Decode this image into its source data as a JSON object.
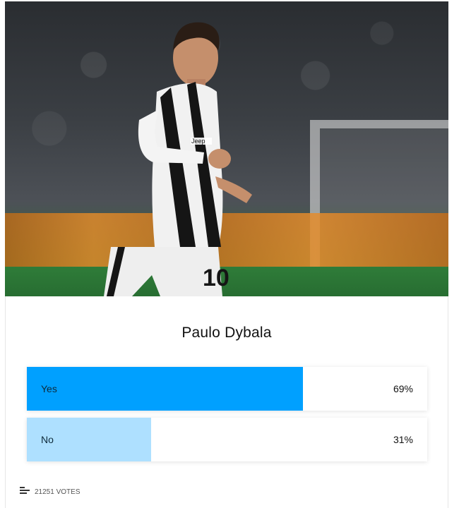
{
  "poll": {
    "title": "Paulo Dybala",
    "options": [
      {
        "label": "Yes",
        "percent_label": "69%",
        "percent": 69,
        "color": "#00a0ff"
      },
      {
        "label": "No",
        "percent_label": "31%",
        "percent": 31,
        "color": "#aee0ff"
      }
    ],
    "votes_label": "21251 VOTES"
  },
  "hero": {
    "jersey_number": "10",
    "sponsor_text": "Jeep"
  },
  "icons": {
    "votes": "bar-chart-icon"
  }
}
